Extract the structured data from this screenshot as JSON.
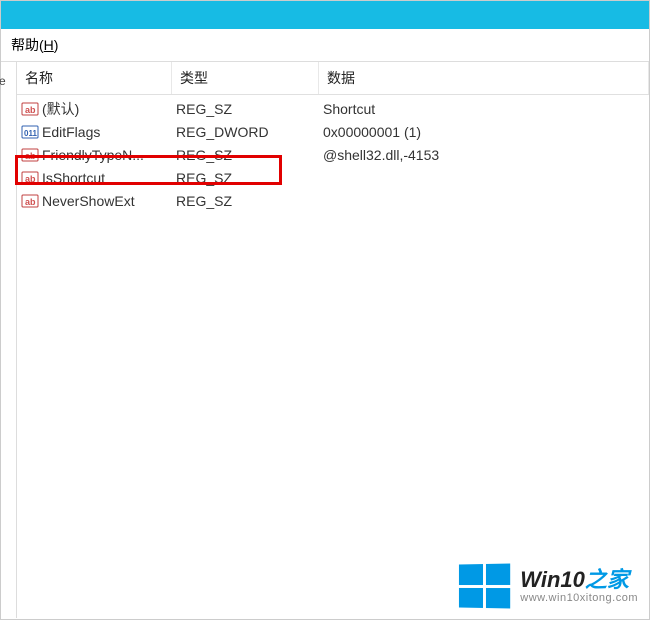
{
  "menu": {
    "help_label": "帮助(",
    "help_accel": "H",
    "help_close": ")"
  },
  "tree_hint": "e",
  "columns": {
    "name": "名称",
    "type": "类型",
    "data": "数据"
  },
  "rows": [
    {
      "icon": "string",
      "name": "(默认)",
      "type": "REG_SZ",
      "data": "Shortcut"
    },
    {
      "icon": "binary",
      "name": "EditFlags",
      "type": "REG_DWORD",
      "data": "0x00000001 (1)"
    },
    {
      "icon": "string",
      "name": "FriendlyTypeN...",
      "type": "REG_SZ",
      "data": "@shell32.dll,-4153"
    },
    {
      "icon": "string",
      "name": "IsShortcut",
      "type": "REG_SZ",
      "data": ""
    },
    {
      "icon": "string",
      "name": "NeverShowExt",
      "type": "REG_SZ",
      "data": ""
    }
  ],
  "watermark": {
    "title_pre": "Win10",
    "title_post": "之家",
    "url": "www.win10xitong.com"
  }
}
